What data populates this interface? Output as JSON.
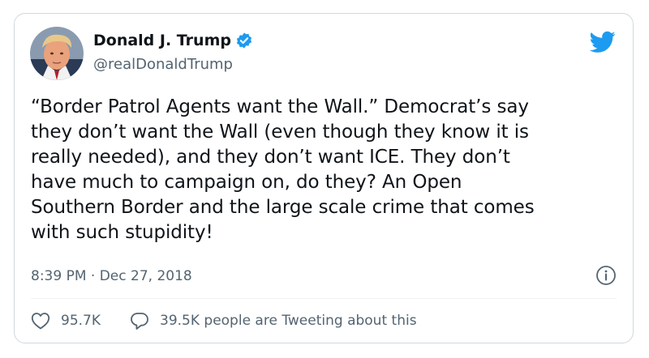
{
  "author": {
    "display_name": "Donald J. Trump",
    "handle": "@realDonaldTrump",
    "verified": true,
    "avatar_icon": "profile-photo"
  },
  "tweet": {
    "text": "“Border Patrol Agents want the Wall.” Democrat’s say\nthey don’t want the Wall (even though they know it is\nreally needed), and they don’t want ICE. They don’t\nhave much to campaign on, do they? An Open\nSouthern Border and the large scale crime that comes\nwith such stupidity!",
    "timestamp": "8:39 PM · Dec 27, 2018"
  },
  "actions": {
    "likes": "95.7K",
    "conversation": "39.5K people are Tweeting about this"
  },
  "colors": {
    "brand_blue": "#1d9bf0",
    "secondary_text": "#536471",
    "border": "#cfd9de"
  },
  "icons": {
    "brand": "twitter-bird-icon",
    "info": "info-icon",
    "like": "heart-icon",
    "reply": "speech-bubble-icon",
    "verified": "verified-badge-icon"
  }
}
